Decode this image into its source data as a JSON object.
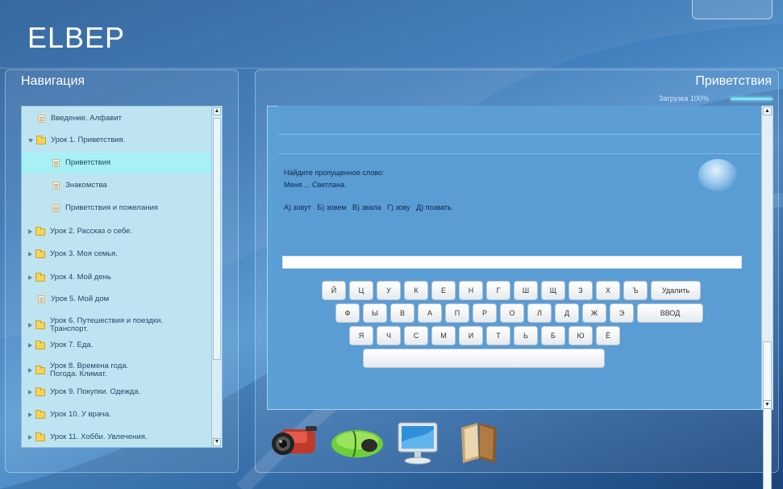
{
  "app": {
    "logo": "ELBEP"
  },
  "nav": {
    "title": "Навигация",
    "items": [
      {
        "label": "Введение. Алфавит",
        "type": "page",
        "selected": false
      },
      {
        "label": "Урок 1. Приветствия.",
        "type": "folder-open",
        "selected": false
      },
      {
        "label": "Приветствия",
        "type": "page",
        "selected": true
      },
      {
        "label": "Знакомства",
        "type": "page",
        "selected": false
      },
      {
        "label": "Приветствия и пожелания",
        "type": "page",
        "selected": false
      },
      {
        "label": "Урок 2. Рассказ о себе.",
        "type": "folder",
        "selected": false
      },
      {
        "label": "Урок 3. Моя семья.",
        "type": "folder",
        "selected": false
      },
      {
        "label": "Урок 4. Мой день",
        "type": "folder",
        "selected": false
      },
      {
        "label": "Урок 5. Мой дом",
        "type": "page",
        "selected": false
      },
      {
        "label": "Урок 6. Путешествия и поездки. Транспорт.",
        "type": "folder",
        "selected": false
      },
      {
        "label": "Урок 7. Еда.",
        "type": "folder",
        "selected": false
      },
      {
        "label": "Урок 8. Времена года. Погода. Климат.",
        "type": "folder",
        "selected": false
      },
      {
        "label": "Урок 9. Покупки. Одежда.",
        "type": "folder",
        "selected": false
      },
      {
        "label": "Урок 10. У врача.",
        "type": "folder",
        "selected": false
      },
      {
        "label": "Урок 11. Хобби. Увлечения.",
        "type": "folder",
        "selected": false
      }
    ]
  },
  "main": {
    "title": "Приветствия",
    "loading": "Загрузка 100%",
    "question": {
      "prompt": "Найдите пропущенное слово:",
      "sentence": "Меня ... Светлана.",
      "options": "А) зовут   Б) зовем   В) звала   Г) зову   Д) позвать"
    },
    "answer": {
      "value": "",
      "placeholder": ""
    }
  },
  "keyboard": {
    "row1": [
      "Й",
      "Ц",
      "У",
      "К",
      "Е",
      "Н",
      "Г",
      "Ш",
      "Щ",
      "З",
      "Х",
      "Ъ",
      "Удалить"
    ],
    "row2": [
      "Ф",
      "Ы",
      "В",
      "А",
      "П",
      "Р",
      "О",
      "Л",
      "Д",
      "Ж",
      "Э",
      "ВВОД"
    ],
    "row3": [
      "Я",
      "Ч",
      "С",
      "М",
      "И",
      "Т",
      "Ь",
      "Б",
      "Ю",
      "Ё"
    ]
  },
  "dock": {
    "icons": [
      "video-camera-icon",
      "mouse-icon",
      "monitor-icon",
      "book-icon"
    ]
  }
}
